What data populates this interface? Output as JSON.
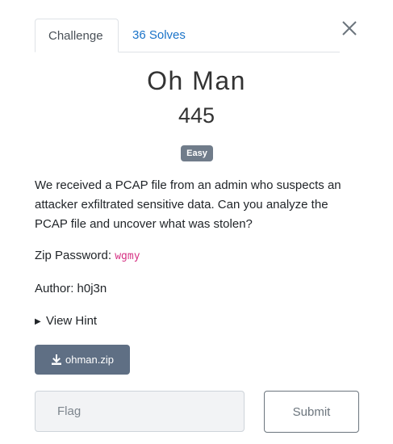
{
  "tabs": [
    {
      "label": "Challenge",
      "active": true
    },
    {
      "label": "36 Solves",
      "active": false
    }
  ],
  "challenge": {
    "title": "Oh Man",
    "points": "445",
    "difficulty": "Easy",
    "description": "We received a PCAP file from an admin who suspects an attacker exfiltrated sensitive data. Can you analyze the PCAP file and uncover what was stolen?",
    "zip_label": "Zip Password:",
    "zip_password": "wgmy",
    "author": "Author: h0j3n",
    "hint_label": "View Hint",
    "download_label": "ohman.zip"
  },
  "form": {
    "flag_placeholder": "Flag",
    "flag_value": "",
    "submit_label": "Submit"
  },
  "icons": {
    "close": "close-icon",
    "download": "download-icon",
    "hint_toggle": "triangle-right-icon"
  },
  "colors": {
    "link": "#1a73c8",
    "badge": "#707c8a",
    "download_button": "#5f6f84",
    "code": "#d63384"
  }
}
